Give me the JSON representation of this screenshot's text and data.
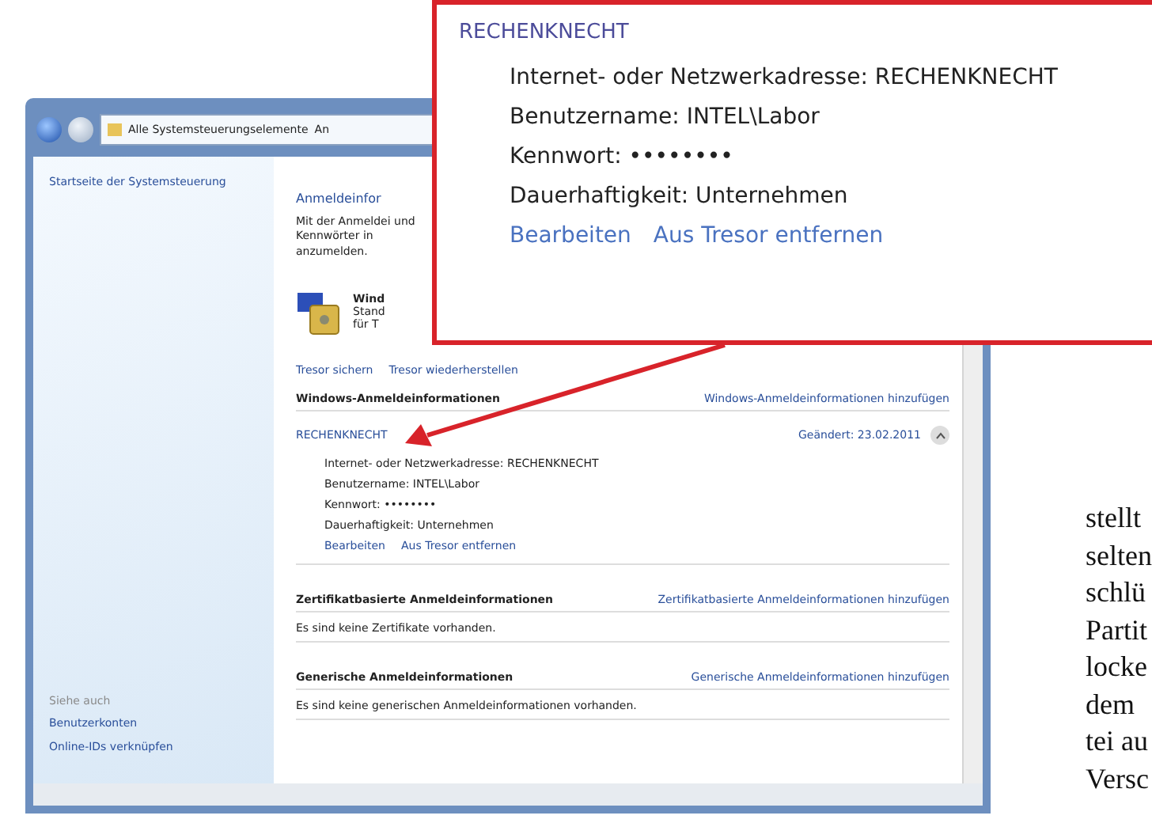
{
  "window": {
    "breadcrumb": [
      "Alle Systemsteuerungselemente",
      "An"
    ]
  },
  "sidebar": {
    "home_link": "Startseite der Systemsteuerung",
    "see_also_title": "Siehe auch",
    "links": [
      "Benutzerkonten",
      "Online-IDs verknüpfen"
    ]
  },
  "main": {
    "title": "Anmeldeinfor",
    "intro": "Mit der Anmeldei und Kennwörter in anzumelden.",
    "vault": {
      "title": "Wind",
      "lines": [
        "Stand",
        "für T"
      ]
    },
    "vault_links": [
      "Tresor sichern",
      "Tresor wiederherstellen"
    ],
    "sections": [
      {
        "title": "Windows-Anmeldeinformationen",
        "add_link": "Windows-Anmeldeinformationen hinzufügen",
        "entries": [
          {
            "name": "RECHENKNECHT",
            "modified": "Geändert: 23.02.2011",
            "expanded": true,
            "details": [
              {
                "label": "Internet- oder Netzwerkadresse:",
                "value": "RECHENKNECHT"
              },
              {
                "label": "Benutzername:",
                "value": "INTEL\\Labor"
              },
              {
                "label": "Kennwort:",
                "value": "••••••••"
              },
              {
                "label": "Dauerhaftigkeit:",
                "value": "Unternehmen"
              }
            ],
            "actions": [
              "Bearbeiten",
              "Aus Tresor entfernen"
            ]
          }
        ]
      },
      {
        "title": "Zertifikatbasierte Anmeldeinformationen",
        "add_link": "Zertifikatbasierte Anmeldeinformationen hinzufügen",
        "empty_text": "Es sind keine Zertifikate vorhanden."
      },
      {
        "title": "Generische Anmeldeinformationen",
        "add_link": "Generische Anmeldeinformationen hinzufügen",
        "empty_text": "Es sind keine generischen Anmeldeinformationen vorhanden."
      }
    ]
  },
  "callout": {
    "name": "RECHENKNECHT",
    "details": [
      {
        "label": "Internet- oder Netzwerkadresse:",
        "value": "RECHENKNECHT"
      },
      {
        "label": "Benutzername:",
        "value": "INTEL\\Labor"
      },
      {
        "label": "Kennwort:",
        "value": "••••••••"
      },
      {
        "label": "Dauerhaftigkeit:",
        "value": "Unternehmen"
      }
    ],
    "actions": [
      "Bearbeiten",
      "Aus Tresor entfernen"
    ]
  },
  "article_lines": [
    "stellt",
    "selten",
    "schlü",
    "Partit",
    "locke",
    "dem",
    "tei au",
    "Versc"
  ]
}
